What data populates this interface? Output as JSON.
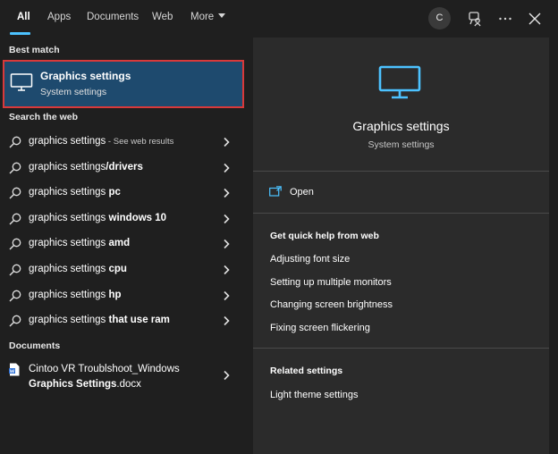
{
  "tabs": [
    {
      "label": "All",
      "active": true
    },
    {
      "label": "Apps"
    },
    {
      "label": "Documents"
    },
    {
      "label": "Web"
    },
    {
      "label": "More"
    }
  ],
  "account_initial": "C",
  "left": {
    "best_match_label": "Best match",
    "best_match": {
      "title": "Graphics settings",
      "subtitle": "System settings",
      "icon": "monitor-icon"
    },
    "search_web_label": "Search the web",
    "web_results": [
      {
        "plain": "graphics settings",
        "bold": "",
        "suffix": " - See web results"
      },
      {
        "plain": "graphics settings",
        "bold": "/drivers",
        "suffix": ""
      },
      {
        "plain": "graphics settings ",
        "bold": "pc",
        "suffix": ""
      },
      {
        "plain": "graphics settings ",
        "bold": "windows 10",
        "suffix": ""
      },
      {
        "plain": "graphics settings ",
        "bold": "amd",
        "suffix": ""
      },
      {
        "plain": "graphics settings ",
        "bold": "cpu",
        "suffix": ""
      },
      {
        "plain": "graphics settings ",
        "bold": "hp",
        "suffix": ""
      },
      {
        "plain": "graphics settings ",
        "bold": "that use ram",
        "suffix": ""
      }
    ],
    "documents_label": "Documents",
    "document": {
      "line1": "Cintoo VR Troublshoot_Windows",
      "line2_bold": "Graphics Settings",
      "line2_rest": ".docx"
    }
  },
  "right": {
    "title": "Graphics settings",
    "subtitle": "System settings",
    "open_label": "Open",
    "quick_help_heading": "Get quick help from web",
    "quick_help_links": [
      "Adjusting font size",
      "Setting up multiple monitors",
      "Changing screen brightness",
      "Fixing screen flickering"
    ],
    "related_heading": "Related settings",
    "related_links": [
      "Light theme settings"
    ]
  },
  "colors": {
    "accent": "#4cc2ff",
    "selection": "#1e4a6e",
    "highlight_border": "#d9393a"
  }
}
